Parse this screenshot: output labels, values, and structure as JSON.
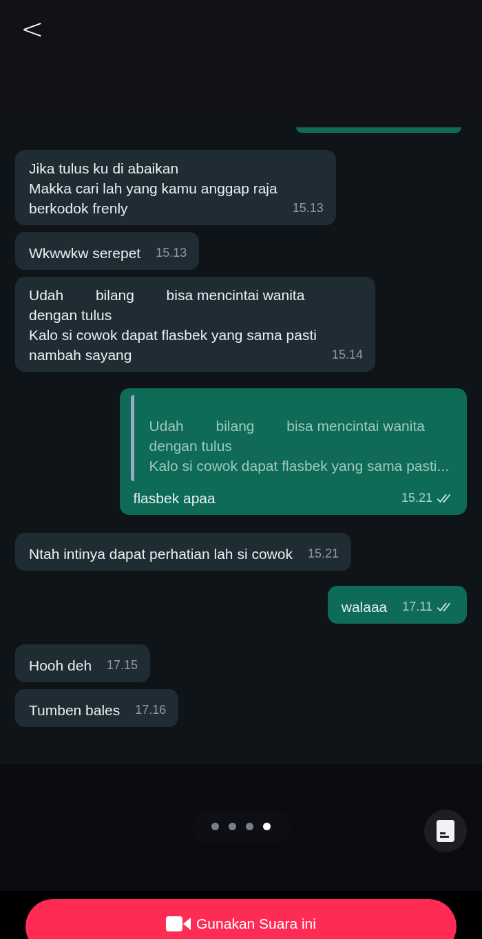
{
  "back": {
    "label": "<"
  },
  "messages": [
    {
      "kind": "in",
      "text": "Jika tulus ku di abaikan\nMakka cari lah yang kamu anggap raja\nberkodok frenly",
      "time": "15.13"
    },
    {
      "kind": "in",
      "text": "Wkwwkw serepet",
      "time": "15.13"
    },
    {
      "kind": "in",
      "text": "Udah        bilang        bisa mencintai wanita\ndengan tulus\nKalo si cowok dapat flasbek yang sama pasti\nnambah sayang",
      "time": "15.14"
    },
    {
      "kind": "out",
      "quote": "Udah        bilang        bisa mencintai wanita\ndengan tulus\nKalo si cowok dapat flasbek yang sama pasti...",
      "text": "flasbek apaa",
      "time": "15.21",
      "read": true
    },
    {
      "kind": "in",
      "text": "Ntah intinya dapat perhatian lah si cowok",
      "time": "15.21"
    },
    {
      "kind": "out",
      "text": "walaaa",
      "time": "17.11",
      "read": true
    },
    {
      "kind": "in",
      "text": "Hooh deh",
      "time": "17.15"
    },
    {
      "kind": "in",
      "text": "Tumben bales",
      "time": "17.16"
    }
  ],
  "pages": [
    {
      "selected": false
    },
    {
      "selected": false
    },
    {
      "selected": false
    },
    {
      "selected": true
    }
  ],
  "action_button": {
    "label": "Gunakan Suara ini"
  }
}
